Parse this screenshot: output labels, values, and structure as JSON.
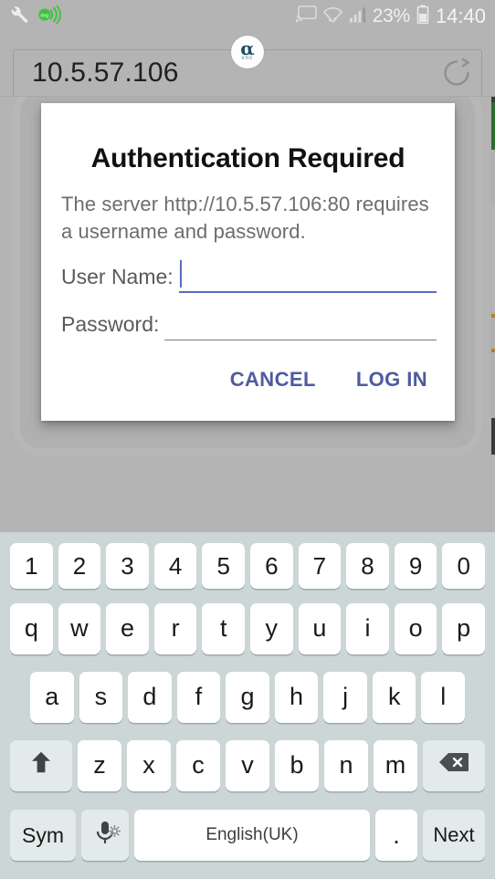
{
  "statusbar": {
    "left_icons": [
      "wrench-icon",
      "ring-broadcast-icon"
    ],
    "right_icons": [
      "cast-icon",
      "wifi-data-icon",
      "signal-bars-icon",
      "battery-icon"
    ],
    "battery_percent": "23%",
    "clock": "14:40"
  },
  "browser": {
    "url": "10.5.57.106",
    "reload_icon": "reload-icon",
    "badge": {
      "alpha": "α",
      "sub": "vnc"
    }
  },
  "dialog": {
    "title": "Authentication Required",
    "message": "The server http://10.5.57.106:80 requires a username and password.",
    "username_label": "User Name:",
    "username_value": "",
    "password_label": "Password:",
    "password_value": "",
    "cancel_label": "CANCEL",
    "login_label": "LOG IN",
    "accent_color": "#5c6bc0",
    "button_color": "#4f5b9e"
  },
  "keyboard": {
    "background_color": "#ccd6d6",
    "key_color": "#ffffff",
    "mod_key_color": "#e2eaea",
    "rows": {
      "numbers": [
        "1",
        "2",
        "3",
        "4",
        "5",
        "6",
        "7",
        "8",
        "9",
        "0"
      ],
      "top": [
        "q",
        "w",
        "e",
        "r",
        "t",
        "y",
        "u",
        "i",
        "o",
        "p"
      ],
      "home": [
        "a",
        "s",
        "d",
        "f",
        "g",
        "h",
        "j",
        "k",
        "l"
      ],
      "shift_row": [
        "z",
        "x",
        "c",
        "v",
        "b",
        "n",
        "m"
      ]
    },
    "shift_key": "shift-icon",
    "backspace_key": "backspace-icon",
    "sym_label": "Sym",
    "mic_key": "microphone-icon",
    "mic_settings": "gear-icon",
    "space_label": "English(UK)",
    "period_label": ".",
    "next_label": "Next"
  }
}
